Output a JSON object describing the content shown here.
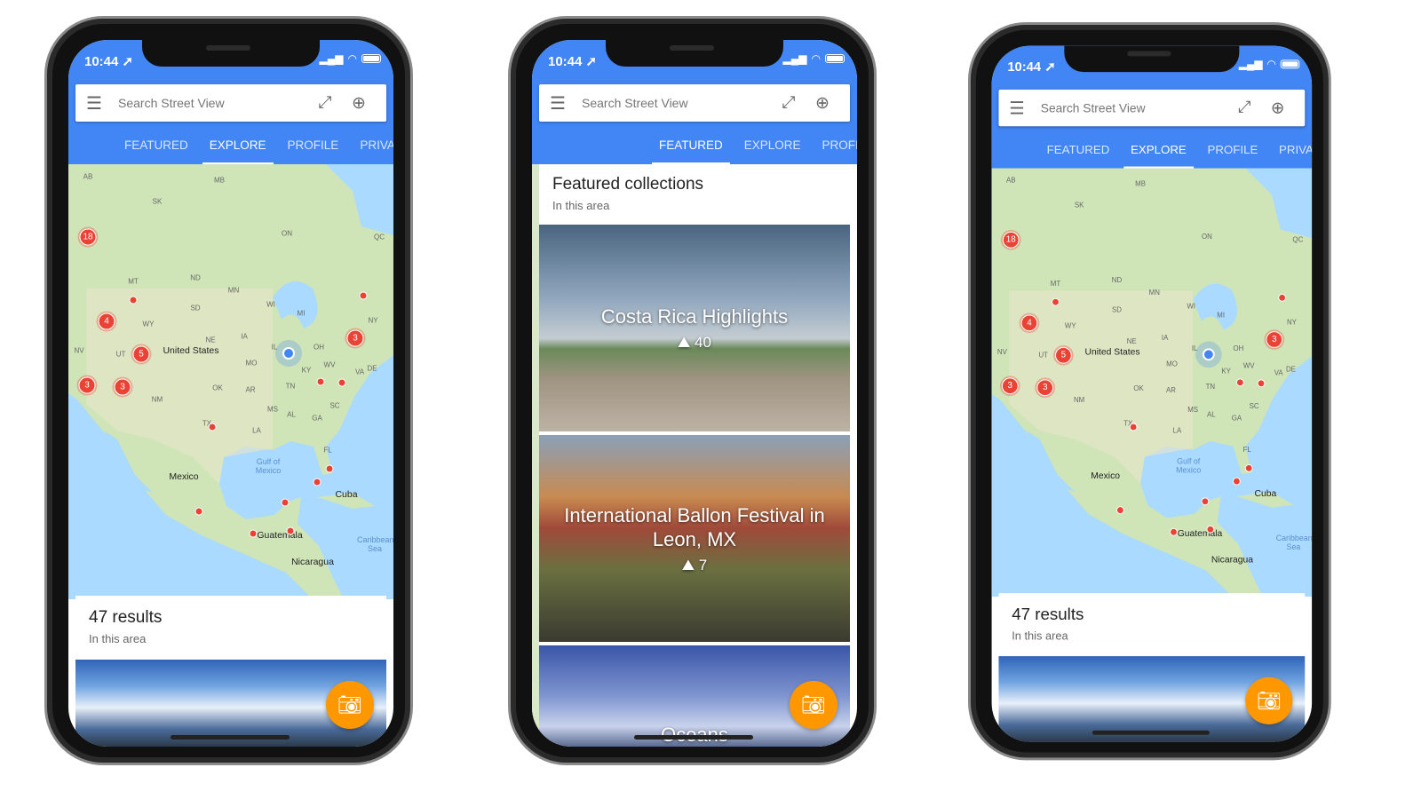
{
  "status": {
    "time": "10:44"
  },
  "search": {
    "placeholder": "Search Street View"
  },
  "icons": {
    "menu": "hamburger-menu-icon",
    "fullscreen": "expand-icon",
    "location": "my-location-icon",
    "fab": "add-photo-camera-icon",
    "collection": "panorama-icon",
    "location_arrow": "location-arrow-icon"
  },
  "tabs": [
    "FEATURED",
    "EXPLORE",
    "PROFILE",
    "PRIVATE"
  ],
  "tabs_short": [
    "FEATURED",
    "EXPLORE",
    "PROFIL"
  ],
  "colors": {
    "primary": "#4285f4",
    "marker": "#ea4335",
    "fab": "#ff9800",
    "water": "#aadaff"
  },
  "map": {
    "labels": [
      "AB",
      "MB",
      "SK",
      "ON",
      "QC",
      "MT",
      "ND",
      "MN",
      "WI",
      "MI",
      "SD",
      "ID",
      "WY",
      "NY",
      "NE",
      "IA",
      "IL",
      "OH",
      "NV",
      "UT",
      "MO",
      "WV",
      "DE",
      "KY",
      "VA",
      "OK",
      "AR",
      "TN",
      "NM",
      "MS",
      "AL",
      "SC",
      "GA",
      "TX",
      "LA",
      "FL"
    ],
    "big_labels": [
      "United States",
      "Mexico",
      "Cuba",
      "Guatemala",
      "Nicaragua"
    ],
    "water_labels": [
      "Gulf of Mexico",
      "Caribbean Sea"
    ],
    "clusters": [
      "18",
      "4",
      "5",
      "3",
      "3",
      "3"
    ]
  },
  "explore": {
    "title": "47 results",
    "subtitle": "In this area"
  },
  "featured": {
    "title": "Featured collections",
    "subtitle": "In this area",
    "collections": [
      {
        "name": "Costa Rica Highlights",
        "count": "40"
      },
      {
        "name": "International Ballon Festival in Leon, MX",
        "count": "7"
      },
      {
        "name": "Oceans",
        "count": ""
      }
    ]
  }
}
